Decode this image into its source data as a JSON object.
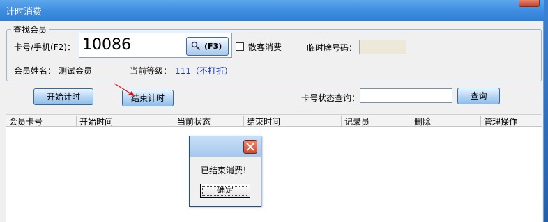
{
  "window": {
    "title": "计时消费"
  },
  "search_group": {
    "legend": "查找会员",
    "card_label": "卡号/手机(F2)：",
    "card_value": "10086",
    "f3_label": "(F3)",
    "walkin_label": "散客消费",
    "temp_plate_label": "临时牌号码：",
    "temp_plate_value": "",
    "member_name_label": "会员姓名：",
    "member_name_value": "测试会员",
    "level_label": "当前等级：",
    "level_value": "111（不打折）"
  },
  "actions": {
    "start_label": "开始计时",
    "end_label": "结束计时",
    "status_query_label": "卡号状态查询：",
    "status_query_value": "",
    "query_button": "查询"
  },
  "table": {
    "columns": [
      "会员卡号",
      "开始时间",
      "当前状态",
      "结束时间",
      "记录员",
      "删除",
      "管理操作"
    ]
  },
  "dialog": {
    "message": "已结束消费！",
    "ok_label": "确定"
  },
  "colors": {
    "title_bar": "#3f8ee0",
    "label_blue": "#1a3aa8",
    "button_blue": "#b9d6f5",
    "close_red": "#d04a2c"
  }
}
